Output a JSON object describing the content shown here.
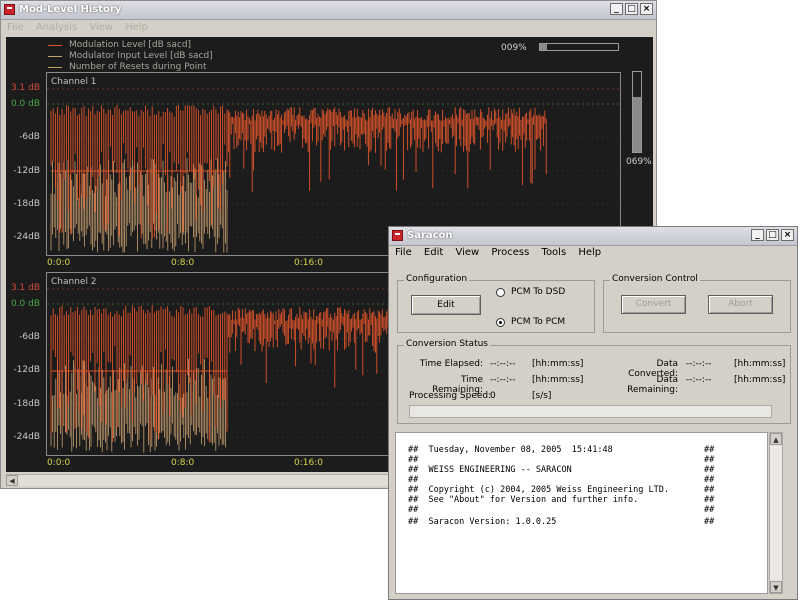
{
  "colors": {
    "trace_modulation": "#e0542a",
    "trace_input": "#c8a070",
    "trace_resets": "#b9a45a",
    "label_red": "#d54a3c",
    "label_green": "#4aa84a",
    "time_label": "#d8d34a"
  },
  "modwin": {
    "title": "Mod-Level History",
    "menu": [
      "File",
      "Analysis",
      "View",
      "Help"
    ],
    "legend": [
      "Modulation Level [dB sacd]",
      "Modulator Input Level [dB sacd]",
      "Number of Resets during Point"
    ],
    "progress_pct": "009%",
    "progress_value": 0.09,
    "level_pct": "069%",
    "level_value": 0.69,
    "channels": [
      {
        "title": "Channel 1",
        "y_labels": [
          "3.1 dB",
          "0.0 dB",
          "-6dB",
          "-12dB",
          "-18dB",
          "-24dB"
        ],
        "x_labels": [
          "0:0:0",
          "0:8:0",
          "0:16:0"
        ]
      },
      {
        "title": "Channel 2",
        "y_labels": [
          "3.1 dB",
          "0.0 dB",
          "-6dB",
          "-12dB",
          "-18dB",
          "-24dB"
        ],
        "x_labels": [
          "0:0:0",
          "0:8:0",
          "0:16:0"
        ]
      }
    ]
  },
  "sarwin": {
    "title": "Saracon",
    "menu": [
      "File",
      "Edit",
      "View",
      "Process",
      "Tools",
      "Help"
    ],
    "config_label": "Configuration",
    "edit_button": "Edit",
    "radio_dsd": "PCM To DSD",
    "radio_pcm": "PCM To PCM",
    "control_label": "Conversion Control",
    "convert_button": "Convert",
    "abort_button": "Abort",
    "status_label": "Conversion Status",
    "time_elapsed_label": "Time Elapsed:",
    "time_elapsed_value": "--:--:--",
    "time_elapsed_unit": "[hh:mm:ss]",
    "time_remaining_label": "Time Remaining:",
    "time_remaining_value": "--:--:--",
    "time_remaining_unit": "[hh:mm:ss]",
    "data_converted_label": "Data Converted:",
    "data_converted_value": "--:--:--",
    "data_converted_unit": "[hh:mm:ss]",
    "data_remaining_label": "Data Remaining:",
    "data_remaining_value": "--:--:--",
    "data_remaining_unit": "[hh:mm:ss]",
    "speed_label": "Processing Speed:",
    "speed_value": "0",
    "speed_unit": "[s/s]",
    "console_lines": [
      "##  Tuesday, November 08, 2005  15:41:48",
      "##",
      "##  WEISS ENGINEERING -- SARACON",
      "##",
      "##  Copyright (c) 2004, 2005 Weiss Engineering LTD.",
      "##  See \"About\" for Version and further info.",
      "##",
      "##  Saracon Version: 1.0.0.25"
    ],
    "console_end": "##"
  }
}
